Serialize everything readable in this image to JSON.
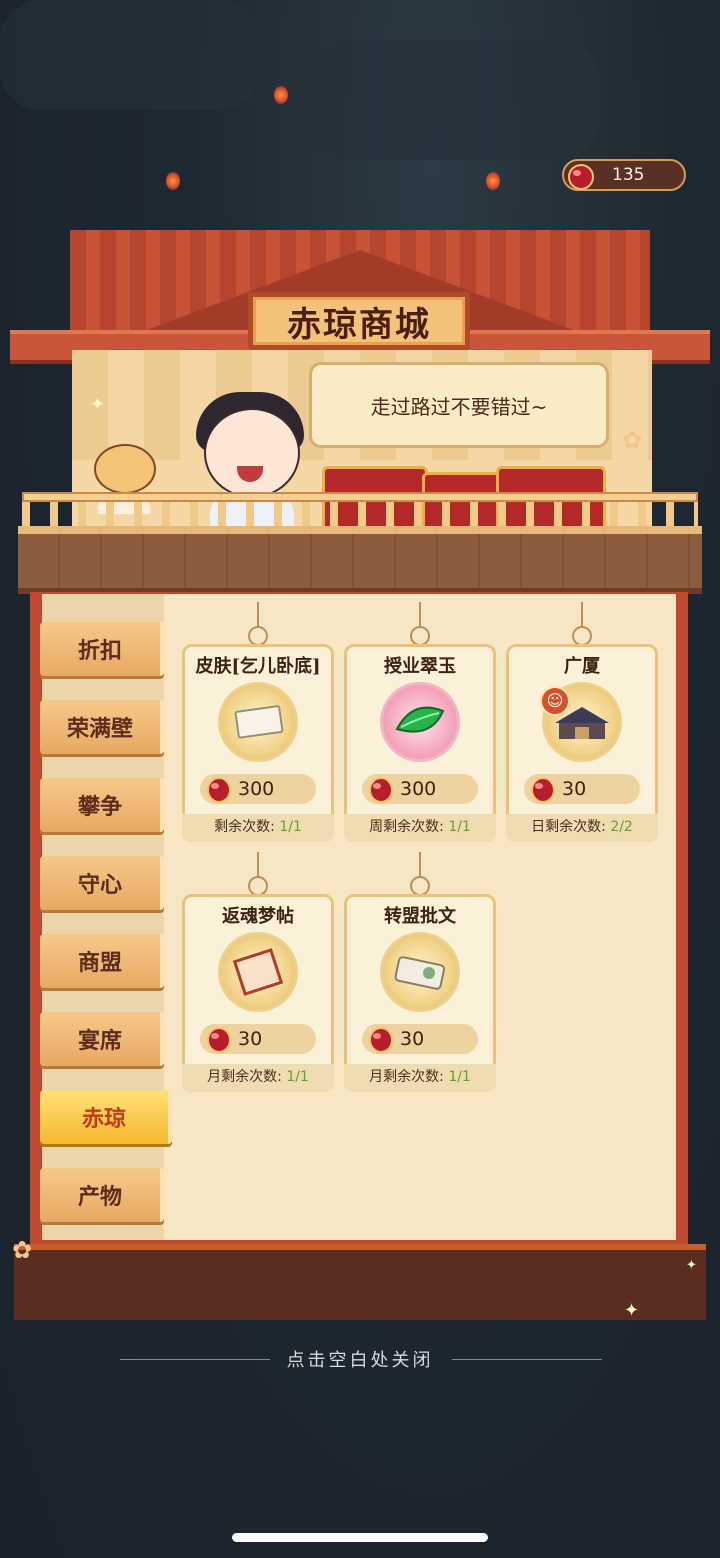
{
  "currency": {
    "amount": "135"
  },
  "shop": {
    "title": "赤琼商城",
    "greeting": "走过路过不要错过~"
  },
  "tabs": [
    {
      "label": "折扣"
    },
    {
      "label": "荣满壁"
    },
    {
      "label": "攀争"
    },
    {
      "label": "守心"
    },
    {
      "label": "商盟"
    },
    {
      "label": "宴席"
    },
    {
      "label": "赤琼",
      "active": true
    },
    {
      "label": "产物"
    }
  ],
  "items": [
    {
      "name": "皮肤[乞儿卧底]",
      "price": "300",
      "limit_label": "剩余次数: ",
      "limit_value": "1/1",
      "icon": "skin-ticket-icon"
    },
    {
      "name": "授业翠玉",
      "price": "300",
      "limit_label": "周剩余次数: ",
      "limit_value": "1/1",
      "icon": "jade-leaf-icon"
    },
    {
      "name": "广厦",
      "price": "30",
      "limit_label": "日剩余次数: ",
      "limit_value": "2/2",
      "icon": "mansion-icon"
    },
    {
      "name": "返魂梦帖",
      "price": "30",
      "limit_label": "月剩余次数: ",
      "limit_value": "1/1",
      "icon": "scroll-icon"
    },
    {
      "name": "转盟批文",
      "price": "30",
      "limit_label": "月剩余次数: ",
      "limit_value": "1/1",
      "icon": "document-scroll-icon"
    }
  ],
  "footer": {
    "close_hint": "点击空白处关闭"
  },
  "colors": {
    "accent": "#c04a2d",
    "active_tab": "#f5b92d",
    "limit_green": "#5da32a"
  }
}
